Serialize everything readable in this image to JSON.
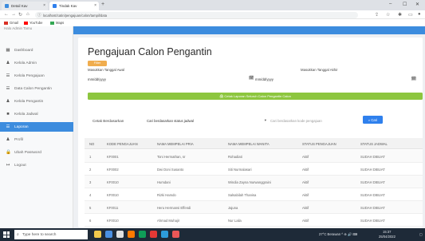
{
  "browser": {
    "tabs": [
      {
        "label": "Detail Kav"
      },
      {
        "label": "Tindak Kav"
      }
    ],
    "new_tab": "+",
    "window_controls": {
      "minimize": "–",
      "maximize": "☐",
      "close": "✕"
    },
    "url": "localhost/catin/pengajuan/calon/tampil/data",
    "bookmarks": [
      {
        "label": "Gmail",
        "color": "#d93025"
      },
      {
        "label": "YouTube",
        "color": "#ff0000"
      },
      {
        "label": "Maps",
        "color": "#34a853"
      }
    ]
  },
  "sidebar": {
    "brand": "Halo Admin Tamu",
    "items": [
      {
        "label": "Dashboard",
        "icon": "dashboard-icon",
        "glyph": "▦"
      },
      {
        "label": "Kelola Admin",
        "icon": "user-icon",
        "glyph": "♟"
      },
      {
        "label": "Kelola Pengajuan",
        "icon": "list-icon",
        "glyph": "☰"
      },
      {
        "label": "Data Calon Pengantin",
        "icon": "list-icon",
        "glyph": "☰"
      },
      {
        "label": "Kelola Pengantin",
        "icon": "users-icon",
        "glyph": "♟"
      },
      {
        "label": "Kelola Jadwal",
        "icon": "calendar-icon",
        "glyph": "■"
      },
      {
        "label": "Laporan",
        "icon": "report-icon",
        "glyph": "☰"
      },
      {
        "label": "Profil",
        "icon": "profile-icon",
        "glyph": "♟"
      },
      {
        "label": "Ubah Password",
        "icon": "lock-icon",
        "glyph": "🔒"
      },
      {
        "label": "Logout",
        "icon": "logout-icon",
        "glyph": "↦"
      }
    ],
    "active_index": 6
  },
  "page": {
    "title": "Pengajuan Calon Pengantin",
    "filter_button": "Filter",
    "start_label": "Masukkan Tanggal Awal",
    "start_placeholder": "mm/dd/yyyy",
    "end_label": "Masukkan Tanggal Akhir",
    "end_placeholder": "mm/dd/yyyy",
    "print_button": "Cetak Laporan Seluruh Calon Pengantin Calon",
    "search_label": "Cetak Berdasarkan",
    "search_select": "Cari berdasarkan status jadwal",
    "search_placeholder": "Cari berdasarkan kode pengajuan",
    "search_button": "Cari"
  },
  "table": {
    "headers": [
      "NO",
      "KODE PENGAJUAN",
      "NAMA MEMPELAI PRIA",
      "NAMA MEMPELAI WANITA",
      "STATUS PENGAJUAN",
      "STATUS JADWAL"
    ],
    "rows": [
      [
        "1",
        "KF0001",
        "Toni Hermathan, sr",
        "Rohadiati",
        "Aktif",
        "SUDAH DIBUAT"
      ],
      [
        "2",
        "KF0002",
        "Dwi Doni Susanto",
        "Siti Nurmalasari",
        "Aktif",
        "SUDAH DIBUAT"
      ],
      [
        "3",
        "KF0010",
        "Humdani",
        "Windia Zayna Nurwanggraini",
        "Aktif",
        "SUDAH DIBUAT"
      ],
      [
        "4",
        "KF0010",
        "Rizki Hamdo",
        "Salsabilah Thanisa",
        "Aktif",
        "SUDAH DIBUAT"
      ],
      [
        "5",
        "KF0011",
        "Heru Hermansi Effendi",
        "Jajuna",
        "Aktif",
        "SUDAH DIBUAT"
      ],
      [
        "6",
        "KF0010",
        "Ahmad Muhajir",
        "Nur Laila",
        "Aktif",
        "SUDAH DIBUAT"
      ]
    ]
  },
  "taskbar": {
    "search_placeholder": "Type here to search",
    "apps": [
      "#f2c94c",
      "#4a90e2",
      "#e0e0e0",
      "#ff7a00",
      "#0f9d58",
      "#e53935",
      "#2d9cdb",
      "#eb5757"
    ],
    "tray_text": "27°C Berawan  ^ ⊕ 🔊 ⌨",
    "time": "15:37",
    "date": "25/04/2022"
  },
  "colors": {
    "accent": "#3c8cde",
    "filter": "#f0ad4e",
    "print": "#8dc63f",
    "search": "#2f80ed"
  }
}
